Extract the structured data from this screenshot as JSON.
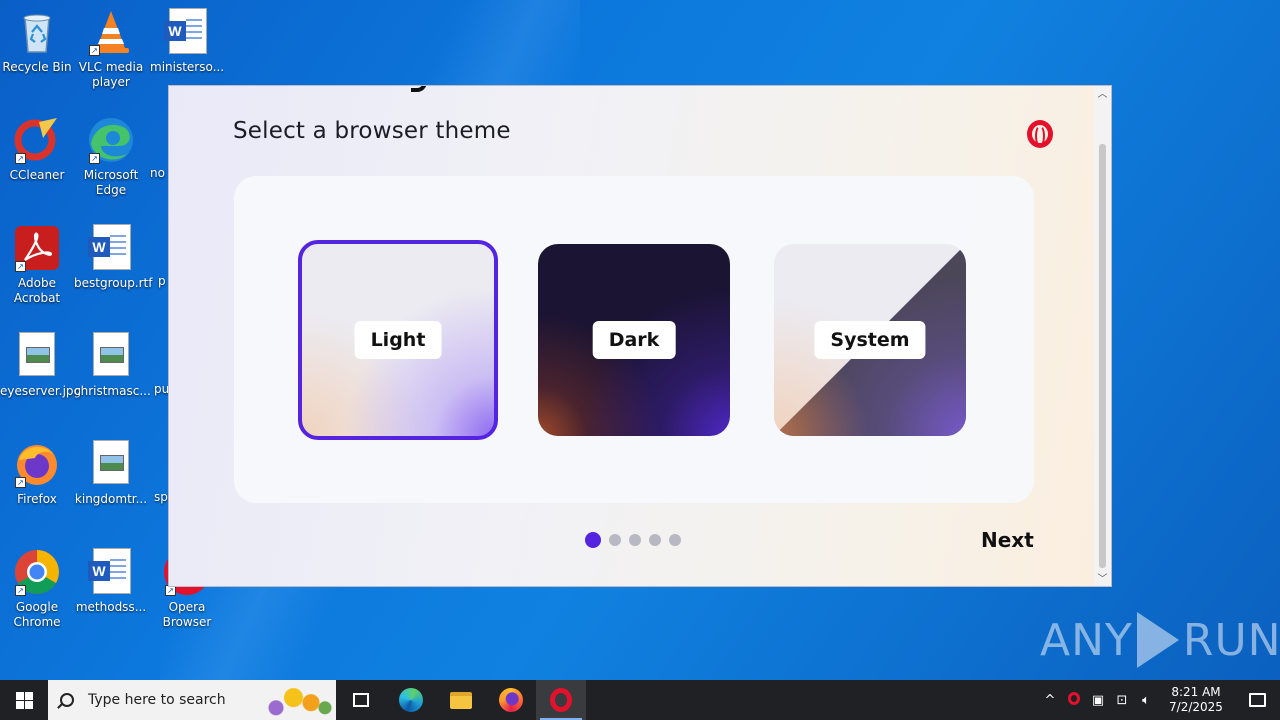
{
  "desktop": {
    "icons": [
      {
        "label": "Recycle Bin"
      },
      {
        "label": "VLC media player"
      },
      {
        "label": "ministerso..."
      },
      {
        "label": "CCleaner"
      },
      {
        "label": "Microsoft Edge"
      },
      {
        "label": "no"
      },
      {
        "label": "Adobe Acrobat"
      },
      {
        "label": "bestgroup.rtf"
      },
      {
        "label": "p"
      },
      {
        "label": "eyeserver.jpg"
      },
      {
        "label": "christmasc..."
      },
      {
        "label": "pu"
      },
      {
        "label": "Firefox"
      },
      {
        "label": "kingdomtr..."
      },
      {
        "label": "sp"
      },
      {
        "label": "Google Chrome"
      },
      {
        "label": "methodss..."
      },
      {
        "label": "Opera Browser"
      }
    ]
  },
  "installer": {
    "heading": "Select a browser theme",
    "themes": [
      {
        "label": "Light",
        "selected": true
      },
      {
        "label": "Dark",
        "selected": false
      },
      {
        "label": "System",
        "selected": false
      }
    ],
    "pagination": {
      "total": 5,
      "current": 1
    },
    "next_label": "Next",
    "accent_color": "#5524e0",
    "brand_color": "#e3112c"
  },
  "watermark": {
    "left": "ANY",
    "right": "RUN"
  },
  "taskbar": {
    "search_placeholder": "Type here to search",
    "pinned": [
      "task-view-icon",
      "edge-icon",
      "file-explorer-icon",
      "firefox-icon",
      "opera-icon"
    ],
    "active_app": "opera-icon",
    "clock_time": "8:21 AM",
    "clock_date": "7/2/2025"
  }
}
